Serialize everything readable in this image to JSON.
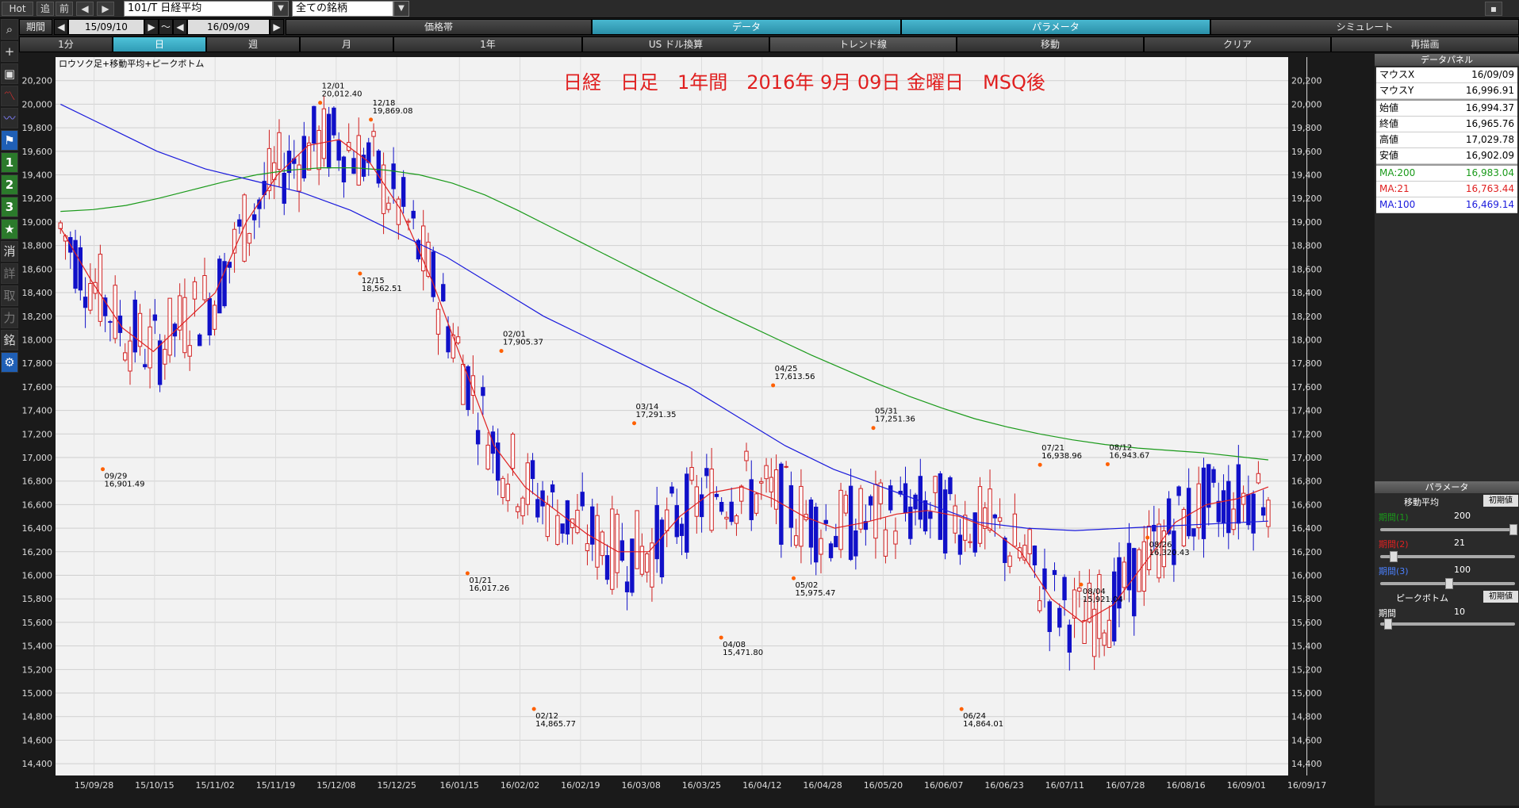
{
  "toolbar": {
    "hot": "Hot",
    "follow": "追",
    "prev": "前",
    "symbol": "101/T 日経平均",
    "universe": "全ての銘柄",
    "period_label": "期間",
    "date_from": "15/09/10",
    "tilde": "～",
    "date_to": "16/09/09"
  },
  "menu_row1": [
    "価格帯",
    "データ",
    "パラメータ",
    "シミュレート"
  ],
  "menu_row2": [
    "1分",
    "日",
    "週",
    "月",
    "1年",
    "US ドル換算",
    "トレンド線",
    "移動",
    "クリア",
    "再描画"
  ],
  "left_buttons": [
    "消",
    "詳",
    "取",
    "力",
    "銘"
  ],
  "left_num": [
    "1",
    "2",
    "3"
  ],
  "chart_data": {
    "type": "candlestick",
    "title": "日経　日足　1年間　2016年 9月 09日 金曜日　MSQ後",
    "subtitle": "ロウソク足+移動平均+ピークボトム",
    "ylim": [
      14300,
      20400
    ],
    "yticks": [
      14400,
      14600,
      14800,
      15000,
      15200,
      15400,
      15600,
      15800,
      16000,
      16200,
      16400,
      16600,
      16800,
      17000,
      17200,
      17400,
      17600,
      17800,
      18000,
      18200,
      18400,
      18600,
      18800,
      19000,
      19200,
      19400,
      19600,
      19800,
      20000,
      20200
    ],
    "x_tick_labels": [
      "15/09/28",
      "15/10/15",
      "15/11/02",
      "15/11/19",
      "15/12/08",
      "15/12/25",
      "16/01/15",
      "16/02/02",
      "16/02/19",
      "16/03/08",
      "16/03/25",
      "16/04/12",
      "16/04/28",
      "16/05/20",
      "16/06/07",
      "16/06/23",
      "16/07/11",
      "16/07/28",
      "16/08/16",
      "16/09/01",
      "16/09/17"
    ],
    "x_tick_pos": [
      0.035,
      0.09,
      0.145,
      0.2,
      0.255,
      0.31,
      0.367,
      0.422,
      0.477,
      0.532,
      0.587,
      0.642,
      0.697,
      0.752,
      0.807,
      0.862,
      0.917,
      0.972,
      1.027,
      1.082,
      1.137
    ],
    "n_bars": 244,
    "ma_series": [
      {
        "name": "MA:200",
        "color": "#1a9a1a",
        "values": [
          19090,
          19105,
          19140,
          19200,
          19270,
          19340,
          19400,
          19440,
          19460,
          19460,
          19440,
          19400,
          19330,
          19230,
          19100,
          18960,
          18820,
          18680,
          18540,
          18400,
          18260,
          18130,
          18000,
          17870,
          17750,
          17630,
          17520,
          17420,
          17330,
          17260,
          17200,
          17150,
          17110,
          17080,
          17060,
          17040,
          17010,
          16980
        ]
      },
      {
        "name": "MA:21",
        "color": "#e02020",
        "values": [
          18950,
          18500,
          18100,
          17900,
          18150,
          18400,
          19000,
          19400,
          19650,
          19700,
          19500,
          19100,
          18500,
          17800,
          17100,
          16750,
          16550,
          16350,
          16200,
          16200,
          16500,
          16700,
          16750,
          16650,
          16500,
          16400,
          16450,
          16520,
          16550,
          16500,
          16400,
          16200,
          15800,
          15600,
          15750,
          16100,
          16450,
          16600,
          16650,
          16750
        ]
      },
      {
        "name": "MA:100",
        "color": "#1a1adc",
        "values": [
          20000,
          19800,
          19600,
          19450,
          19350,
          19250,
          19100,
          18900,
          18700,
          18450,
          18200,
          18000,
          17800,
          17600,
          17350,
          17100,
          16900,
          16750,
          16600,
          16450,
          16400,
          16380,
          16400,
          16420,
          16440,
          16460
        ]
      }
    ],
    "peaks": [
      {
        "date": "09/29",
        "value": "16,901.49",
        "pos": 0.035,
        "y": 16901,
        "type": "bottom"
      },
      {
        "date": "12/01",
        "value": "20,012.40",
        "pos": 0.215,
        "y": 20012,
        "type": "peak"
      },
      {
        "date": "12/18",
        "value": "19,869.08",
        "pos": 0.257,
        "y": 19869,
        "type": "peak"
      },
      {
        "date": "12/15",
        "value": "18,562.51",
        "pos": 0.248,
        "y": 18562,
        "type": "bottom"
      },
      {
        "date": "01/21",
        "value": "16,017.26",
        "pos": 0.337,
        "y": 16017,
        "type": "bottom"
      },
      {
        "date": "02/01",
        "value": "17,905.37",
        "pos": 0.365,
        "y": 17905,
        "type": "peak"
      },
      {
        "date": "02/12",
        "value": "14,865.77",
        "pos": 0.392,
        "y": 14865,
        "type": "bottom"
      },
      {
        "date": "03/14",
        "value": "17,291.35",
        "pos": 0.475,
        "y": 17291,
        "type": "peak"
      },
      {
        "date": "04/08",
        "value": "15,471.80",
        "pos": 0.547,
        "y": 15471,
        "type": "bottom"
      },
      {
        "date": "04/25",
        "value": "17,613.56",
        "pos": 0.59,
        "y": 17613,
        "type": "peak"
      },
      {
        "date": "05/02",
        "value": "15,975.47",
        "pos": 0.607,
        "y": 15975,
        "type": "bottom"
      },
      {
        "date": "05/31",
        "value": "17,251.36",
        "pos": 0.673,
        "y": 17251,
        "type": "peak"
      },
      {
        "date": "06/24",
        "value": "14,864.01",
        "pos": 0.746,
        "y": 14864,
        "type": "bottom"
      },
      {
        "date": "07/21",
        "value": "16,938.96",
        "pos": 0.811,
        "y": 16938,
        "type": "peak"
      },
      {
        "date": "08/04",
        "value": "15,921.04",
        "pos": 0.845,
        "y": 15921,
        "type": "bottom"
      },
      {
        "date": "08/12",
        "value": "16,943.67",
        "pos": 0.867,
        "y": 16943,
        "type": "peak"
      },
      {
        "date": "08/26",
        "value": "16,320.43",
        "pos": 0.9,
        "y": 16320,
        "type": "bottom"
      }
    ]
  },
  "data_panel": {
    "header": "データパネル",
    "rows": [
      {
        "k": "マウスX",
        "v": "16/09/09",
        "c": "#000"
      },
      {
        "k": "マウスY",
        "v": "16,996.91",
        "c": "#000"
      },
      {
        "k": "始値",
        "v": "16,994.37",
        "c": "#000"
      },
      {
        "k": "終値",
        "v": "16,965.76",
        "c": "#000"
      },
      {
        "k": "高値",
        "v": "17,029.78",
        "c": "#000"
      },
      {
        "k": "安値",
        "v": "16,902.09",
        "c": "#000"
      },
      {
        "k": "MA:200",
        "v": "16,983.04",
        "c": "#1a9a1a"
      },
      {
        "k": "MA:21",
        "v": "16,763.44",
        "c": "#e02020"
      },
      {
        "k": "MA:100",
        "v": "16,469.14",
        "c": "#1a1adc"
      }
    ]
  },
  "param_panel": {
    "header": "パラメータ",
    "ma_title": "移動平均",
    "init": "初期値",
    "p1_label": "期間(1)",
    "p1_value": "200",
    "p2_label": "期間(2)",
    "p2_value": "21",
    "p3_label": "期間(3)",
    "p3_value": "100",
    "pb_title": "ピークボトム",
    "pb_label": "期間",
    "pb_value": "10"
  }
}
